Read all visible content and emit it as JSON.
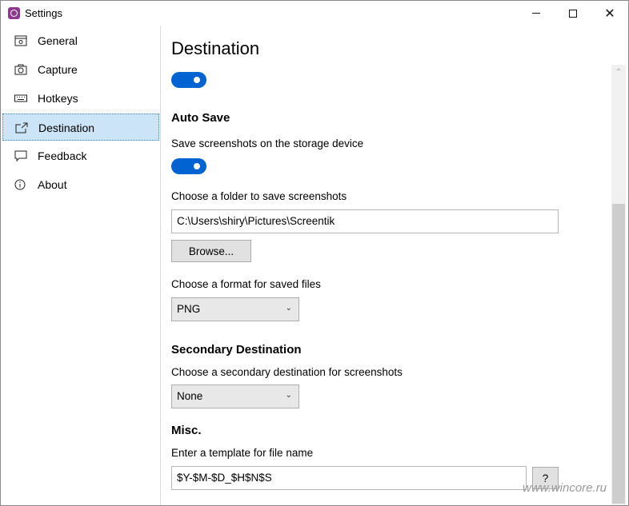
{
  "window": {
    "title": "Settings",
    "min_icon": "minimize-icon",
    "max_icon": "maximize-icon",
    "close_icon": "close-icon",
    "close_glyph": "✕"
  },
  "sidebar": {
    "items": [
      {
        "label": "General",
        "icon": "general-settings-icon",
        "selected": false
      },
      {
        "label": "Capture",
        "icon": "camera-icon",
        "selected": false
      },
      {
        "label": "Hotkeys",
        "icon": "keyboard-icon",
        "selected": false
      },
      {
        "label": "Destination",
        "icon": "export-icon",
        "selected": true
      },
      {
        "label": "Feedback",
        "icon": "feedback-icon",
        "selected": false
      },
      {
        "label": "About",
        "icon": "info-icon",
        "selected": false
      }
    ]
  },
  "main": {
    "title": "Destination",
    "destination_toggle_on": true,
    "auto_save": {
      "heading": "Auto Save",
      "toggle_label": "Save screenshots on the storage device",
      "toggle_on": true,
      "folder_label": "Choose a folder to save screenshots",
      "folder_value": "C:\\Users\\shiry\\Pictures\\Screentik",
      "browse_label": "Browse...",
      "format_label": "Choose a format for saved files",
      "format_value": "PNG"
    },
    "secondary": {
      "heading": "Secondary Destination",
      "label": "Choose a secondary destination for screenshots",
      "value": "None"
    },
    "misc": {
      "heading": "Misc.",
      "label": "Enter a template for file name",
      "template_value": "$Y-$M-$D_$H$N$S",
      "help_label": "?"
    }
  },
  "colors": {
    "accent": "#0063d1",
    "selected_bg": "#cce4f7",
    "app_icon": "#8c3a8e"
  },
  "watermark": "www.wincore.ru"
}
